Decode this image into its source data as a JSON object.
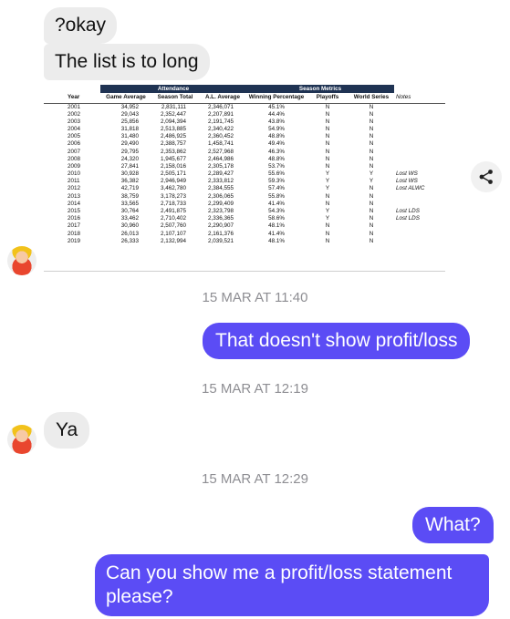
{
  "messages": {
    "in_okay": "?okay",
    "in_list": "The list is to long",
    "ts1": "15 MAR AT 11:40",
    "out_profit": "That doesn't show profit/loss",
    "ts2": "15 MAR AT 12:19",
    "in_ya": "Ya",
    "ts3": "15 MAR AT 12:29",
    "out_what": "What?",
    "out_statement": "Can you show me a profit/loss statement please?"
  },
  "table": {
    "group_attendance": "Attendance",
    "group_season": "Season Metrics",
    "headers": [
      "Year",
      "Game Average",
      "Season Total",
      "A.L. Average",
      "Winning Percentage",
      "Playoffs",
      "World Series",
      "Notes"
    ],
    "rows": [
      [
        "2001",
        "34,952",
        "2,831,111",
        "2,346,071",
        "45.1%",
        "N",
        "N",
        ""
      ],
      [
        "2002",
        "29,043",
        "2,352,447",
        "2,207,891",
        "44.4%",
        "N",
        "N",
        ""
      ],
      [
        "2003",
        "25,856",
        "2,094,394",
        "2,191,745",
        "43.8%",
        "N",
        "N",
        ""
      ],
      [
        "2004",
        "31,818",
        "2,513,885",
        "2,340,422",
        "54.9%",
        "N",
        "N",
        ""
      ],
      [
        "2005",
        "31,480",
        "2,486,925",
        "2,360,452",
        "48.8%",
        "N",
        "N",
        ""
      ],
      [
        "2006",
        "29,490",
        "2,388,757",
        "1,458,741",
        "49.4%",
        "N",
        "N",
        ""
      ],
      [
        "2007",
        "29,795",
        "2,353,862",
        "2,527,968",
        "46.3%",
        "N",
        "N",
        ""
      ],
      [
        "2008",
        "24,320",
        "1,945,677",
        "2,464,986",
        "48.8%",
        "N",
        "N",
        ""
      ],
      [
        "2009",
        "27,841",
        "2,158,016",
        "2,305,178",
        "53.7%",
        "N",
        "N",
        ""
      ],
      [
        "2010",
        "30,928",
        "2,505,171",
        "2,289,427",
        "55.6%",
        "Y",
        "Y",
        "Lost WS"
      ],
      [
        "2011",
        "36,382",
        "2,946,949",
        "2,333,812",
        "59.3%",
        "Y",
        "Y",
        "Lost WS"
      ],
      [
        "2012",
        "42,719",
        "3,462,780",
        "2,384,555",
        "57.4%",
        "Y",
        "N",
        "Lost ALWC"
      ],
      [
        "2013",
        "38,759",
        "3,178,273",
        "2,306,065",
        "55.8%",
        "N",
        "N",
        ""
      ],
      [
        "2014",
        "33,565",
        "2,718,733",
        "2,299,409",
        "41.4%",
        "N",
        "N",
        ""
      ],
      [
        "2015",
        "30,764",
        "2,491,875",
        "2,323,798",
        "54.3%",
        "Y",
        "N",
        "Lost LDS"
      ],
      [
        "2016",
        "33,462",
        "2,710,402",
        "2,336,365",
        "58.6%",
        "Y",
        "N",
        "Lost LDS"
      ],
      [
        "2017",
        "30,960",
        "2,507,760",
        "2,290,907",
        "48.1%",
        "N",
        "N",
        ""
      ],
      [
        "2018",
        "26,013",
        "2,107,107",
        "2,161,376",
        "41.4%",
        "N",
        "N",
        ""
      ],
      [
        "2019",
        "26,333",
        "2,132,994",
        "2,039,521",
        "48.1%",
        "N",
        "N",
        ""
      ]
    ]
  },
  "colors": {
    "outgoing_bubble": "#5b4cf5",
    "incoming_bubble": "#ececec",
    "timestamp": "#8e8e93",
    "table_group_header": "#1f3353"
  },
  "icons": {
    "share": "share-icon",
    "avatar": "avatar"
  }
}
